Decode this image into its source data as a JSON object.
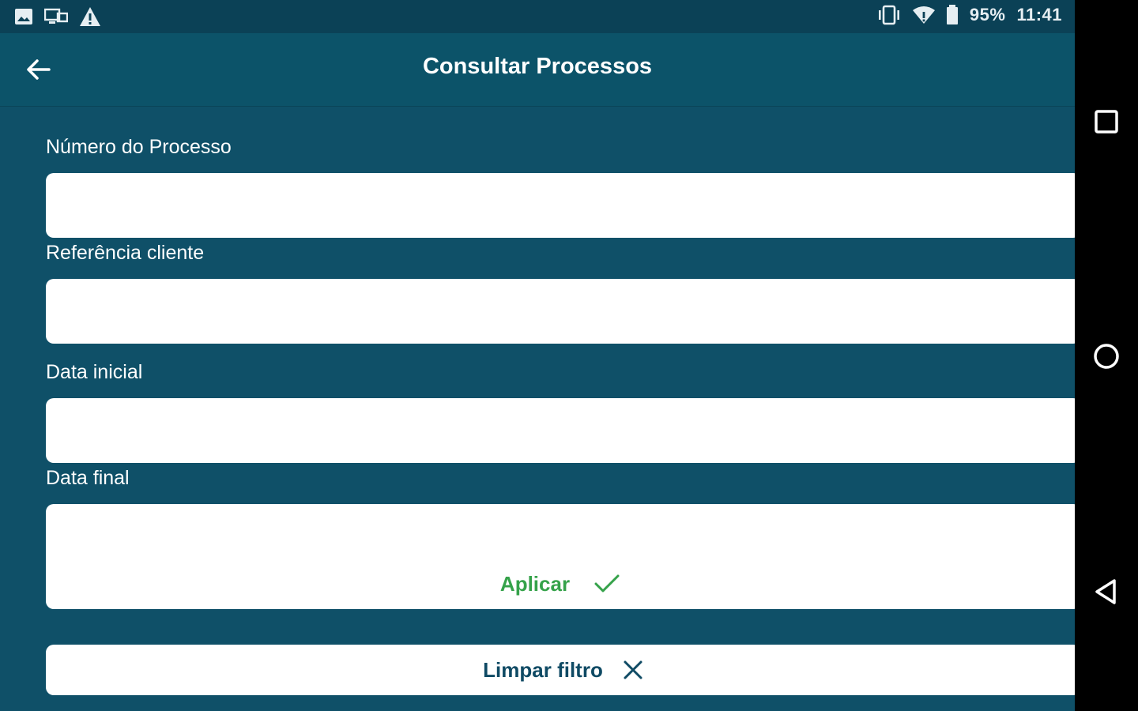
{
  "statusbar": {
    "battery": "95%",
    "time": "11:41",
    "icons_left": [
      "image-icon",
      "cast-icon",
      "warning-icon"
    ],
    "icons_right": [
      "vibrate-icon",
      "wifi-icon",
      "battery-icon"
    ]
  },
  "appbar": {
    "title": "Consultar Processos",
    "back_icon": "arrow-left-icon"
  },
  "form": {
    "numero_label": "Número do Processo",
    "numero_value": "",
    "referencia_label": "Referência cliente",
    "referencia_value": "",
    "data_inicial_label": "Data inicial",
    "data_inicial_value": "",
    "data_final_label": "Data final",
    "data_final_value": ""
  },
  "actions": {
    "apply_label": "Aplicar",
    "apply_icon": "check-icon",
    "clear_label": "Limpar filtro",
    "clear_icon": "close-icon"
  },
  "colors": {
    "background": "#0f5068",
    "appbar": "#0c5369",
    "apply": "#35a24a",
    "clear_text": "#0f4a64"
  },
  "navbar": {
    "icons": [
      "recents-square-icon",
      "home-circle-icon",
      "back-triangle-icon"
    ]
  }
}
